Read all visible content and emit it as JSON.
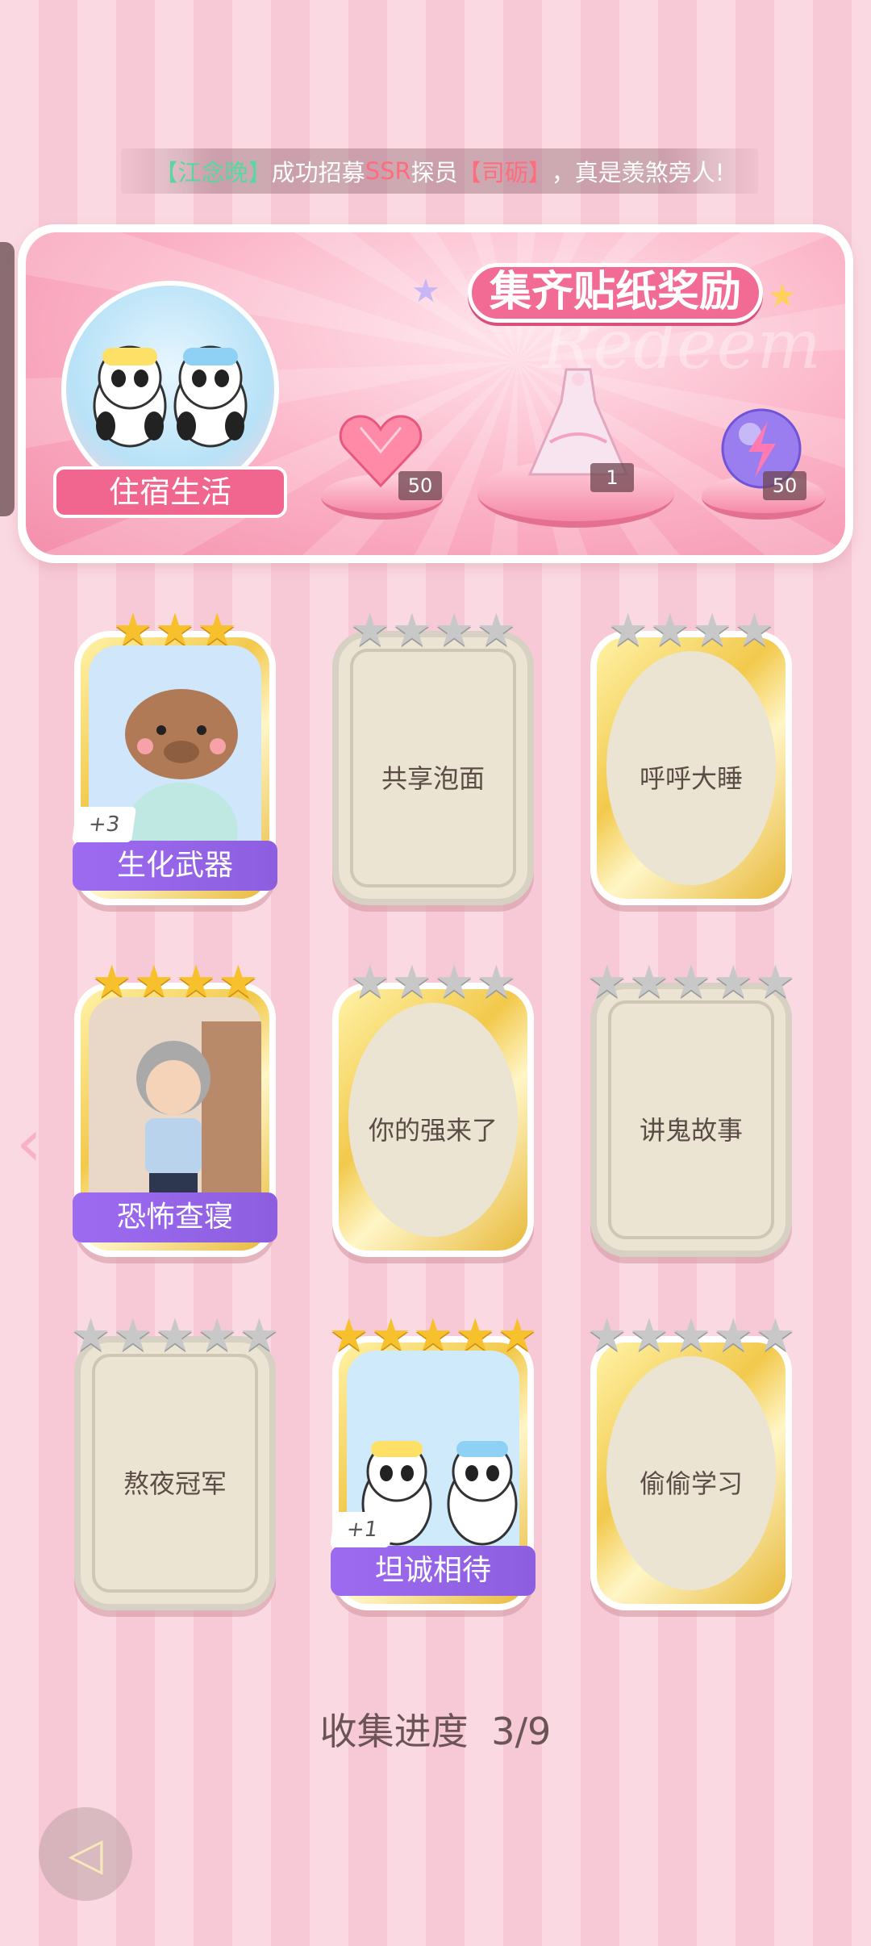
{
  "ticker": {
    "prefix_bracket_open": "【",
    "player_name": "江念晚",
    "bracket_close": "】",
    "middle_text": "成功招募",
    "rarity": "SSR",
    "role": "探员",
    "agent_name_open": "【",
    "agent_name": "司砺",
    "agent_name_close": "】",
    "suffix": "，真是羡煞旁人!"
  },
  "banner": {
    "title": "集齐贴纸奖励",
    "watermark": "Redeem",
    "theme_label": "住宿生活",
    "rewards": [
      {
        "icon": "heart-gem-icon",
        "count": "50"
      },
      {
        "icon": "dress-outfit-icon",
        "count": "1"
      },
      {
        "icon": "energy-orb-icon",
        "count": "50"
      }
    ]
  },
  "cards": [
    {
      "title": "生化武器",
      "collected": true,
      "stars": 3,
      "max_stars": 3,
      "badge": "+3",
      "style": "gold",
      "art": "capybara-pajamas"
    },
    {
      "title": "共享泡面",
      "collected": false,
      "stars": 0,
      "max_stars": 4,
      "style": "silver"
    },
    {
      "title": "呼呼大睡",
      "collected": false,
      "stars": 0,
      "max_stars": 4,
      "style": "gold"
    },
    {
      "title": "恐怖查寝",
      "collected": true,
      "stars": 4,
      "max_stars": 4,
      "badge": "",
      "style": "gold",
      "art": "dorm-matron"
    },
    {
      "title": "你的强来了",
      "collected": false,
      "stars": 0,
      "max_stars": 4,
      "style": "gold"
    },
    {
      "title": "讲鬼故事",
      "collected": false,
      "stars": 0,
      "max_stars": 5,
      "style": "silver"
    },
    {
      "title": "熬夜冠军",
      "collected": false,
      "stars": 0,
      "max_stars": 5,
      "style": "silver"
    },
    {
      "title": "坦诚相待",
      "collected": true,
      "stars": 5,
      "max_stars": 5,
      "badge": "+1",
      "style": "gold",
      "art": "pandas-bath"
    },
    {
      "title": "偷偷学习",
      "collected": false,
      "stars": 0,
      "max_stars": 5,
      "style": "gold"
    }
  ],
  "progress": {
    "label": "收集进度",
    "value": "3/9"
  },
  "nav": {
    "left_arrow_icon": "chevron-left-icon",
    "back_icon": "back-arrow-icon"
  },
  "colors": {
    "accent_pink": "#f26b94",
    "ribbon_purple": "#9d6bf0",
    "star_gold": "#f6c12c",
    "star_gray": "#c8c8c8"
  }
}
